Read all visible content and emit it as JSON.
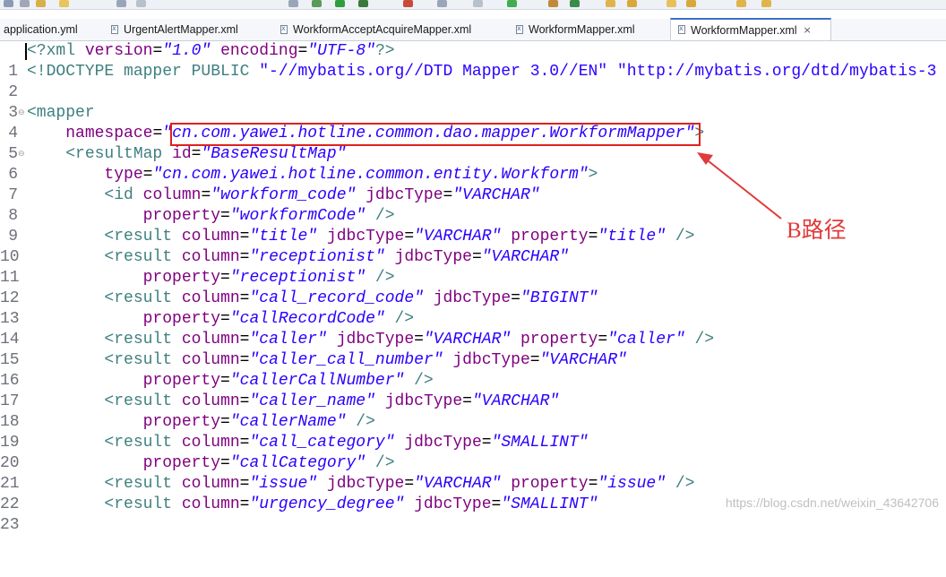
{
  "tabs": [
    {
      "label": "application.yml",
      "active": false
    },
    {
      "label": "UrgentAlertMapper.xml",
      "active": false
    },
    {
      "label": "WorkformAcceptAcquireMapper.xml",
      "active": false
    },
    {
      "label": "WorkformMapper.xml",
      "active": false
    },
    {
      "label": "WorkformMapper.xml",
      "active": true,
      "close": "×"
    }
  ],
  "editor": {
    "line_numbers": [
      "1",
      "2",
      "3",
      "4",
      "5",
      "6",
      "7",
      "8",
      "9",
      "10",
      "11",
      "12",
      "13",
      "14",
      "15",
      "16",
      "17",
      "18",
      "19",
      "20",
      "21",
      "22",
      "23"
    ],
    "l1": {
      "open": "<?",
      "name": "xml",
      "a1": "version",
      "v1": "\"1.0\"",
      "a2": "encoding",
      "v2": "\"UTF-8\"",
      "close": "?>"
    },
    "l2": {
      "doctype": "<!DOCTYPE mapper PUBLIC ",
      "pub": "\"-//mybatis.org//DTD Mapper 3.0//EN\"",
      "sys": "\"http://mybatis.org/dtd/mybatis-3"
    },
    "l4": {
      "tag": "<mapper"
    },
    "l5": {
      "attr": "namespace",
      "val_open": "\"",
      "val": "cn.com.yawei.hotline.common.dao.mapper.WorkformMapper",
      "val_close": "\"",
      "close": ">"
    },
    "l6": {
      "tag": "<resultMap",
      "attr": "id",
      "val": "\"BaseResultMap\""
    },
    "l7": {
      "attr": "type",
      "val": "\"cn.com.yawei.hotline.common.entity.Workform\"",
      "close": ">"
    },
    "l8": {
      "tag": "<id",
      "a1": "column",
      "v1": "\"workform_code\"",
      "a2": "jdbcType",
      "v2": "\"VARCHAR\""
    },
    "l9": {
      "attr": "property",
      "val": "\"workformCode\"",
      "close": "/>"
    },
    "l10": {
      "tag": "<result",
      "a1": "column",
      "v1": "\"title\"",
      "a2": "jdbcType",
      "v2": "\"VARCHAR\"",
      "a3": "property",
      "v3": "\"title\"",
      "close": "/>"
    },
    "l11": {
      "tag": "<result",
      "a1": "column",
      "v1": "\"receptionist\"",
      "a2": "jdbcType",
      "v2": "\"VARCHAR\""
    },
    "l12": {
      "attr": "property",
      "val": "\"receptionist\"",
      "close": "/>"
    },
    "l13": {
      "tag": "<result",
      "a1": "column",
      "v1": "\"call_record_code\"",
      "a2": "jdbcType",
      "v2": "\"BIGINT\""
    },
    "l14": {
      "attr": "property",
      "val": "\"callRecordCode\"",
      "close": "/>"
    },
    "l15": {
      "tag": "<result",
      "a1": "column",
      "v1": "\"caller\"",
      "a2": "jdbcType",
      "v2": "\"VARCHAR\"",
      "a3": "property",
      "v3": "\"caller\"",
      "close": "/>"
    },
    "l16": {
      "tag": "<result",
      "a1": "column",
      "v1": "\"caller_call_number\"",
      "a2": "jdbcType",
      "v2": "\"VARCHAR\""
    },
    "l17": {
      "attr": "property",
      "val": "\"callerCallNumber\"",
      "close": "/>"
    },
    "l18": {
      "tag": "<result",
      "a1": "column",
      "v1": "\"caller_name\"",
      "a2": "jdbcType",
      "v2": "\"VARCHAR\""
    },
    "l19": {
      "attr": "property",
      "val": "\"callerName\"",
      "close": "/>"
    },
    "l20": {
      "tag": "<result",
      "a1": "column",
      "v1": "\"call_category\"",
      "a2": "jdbcType",
      "v2": "\"SMALLINT\""
    },
    "l21": {
      "attr": "property",
      "val": "\"callCategory\"",
      "close": "/>"
    },
    "l22": {
      "tag": "<result",
      "a1": "column",
      "v1": "\"issue\"",
      "a2": "jdbcType",
      "v2": "\"VARCHAR\"",
      "a3": "property",
      "v3": "\"issue\"",
      "close": "/>"
    },
    "l23": {
      "tag": "<result",
      "a1": "column",
      "v1": "\"urgency_degree\"",
      "a2": "jdbcType",
      "v2": "\"SMALLINT\""
    }
  },
  "annotation": {
    "label": "B路径",
    "color": "#e03a3a"
  },
  "watermark": "https://blog.csdn.net/weixin_43642706",
  "colors": {
    "tag": "#3f7f7f",
    "attr": "#7f007f",
    "value": "#2a00ff",
    "highlight": "#e02020"
  }
}
